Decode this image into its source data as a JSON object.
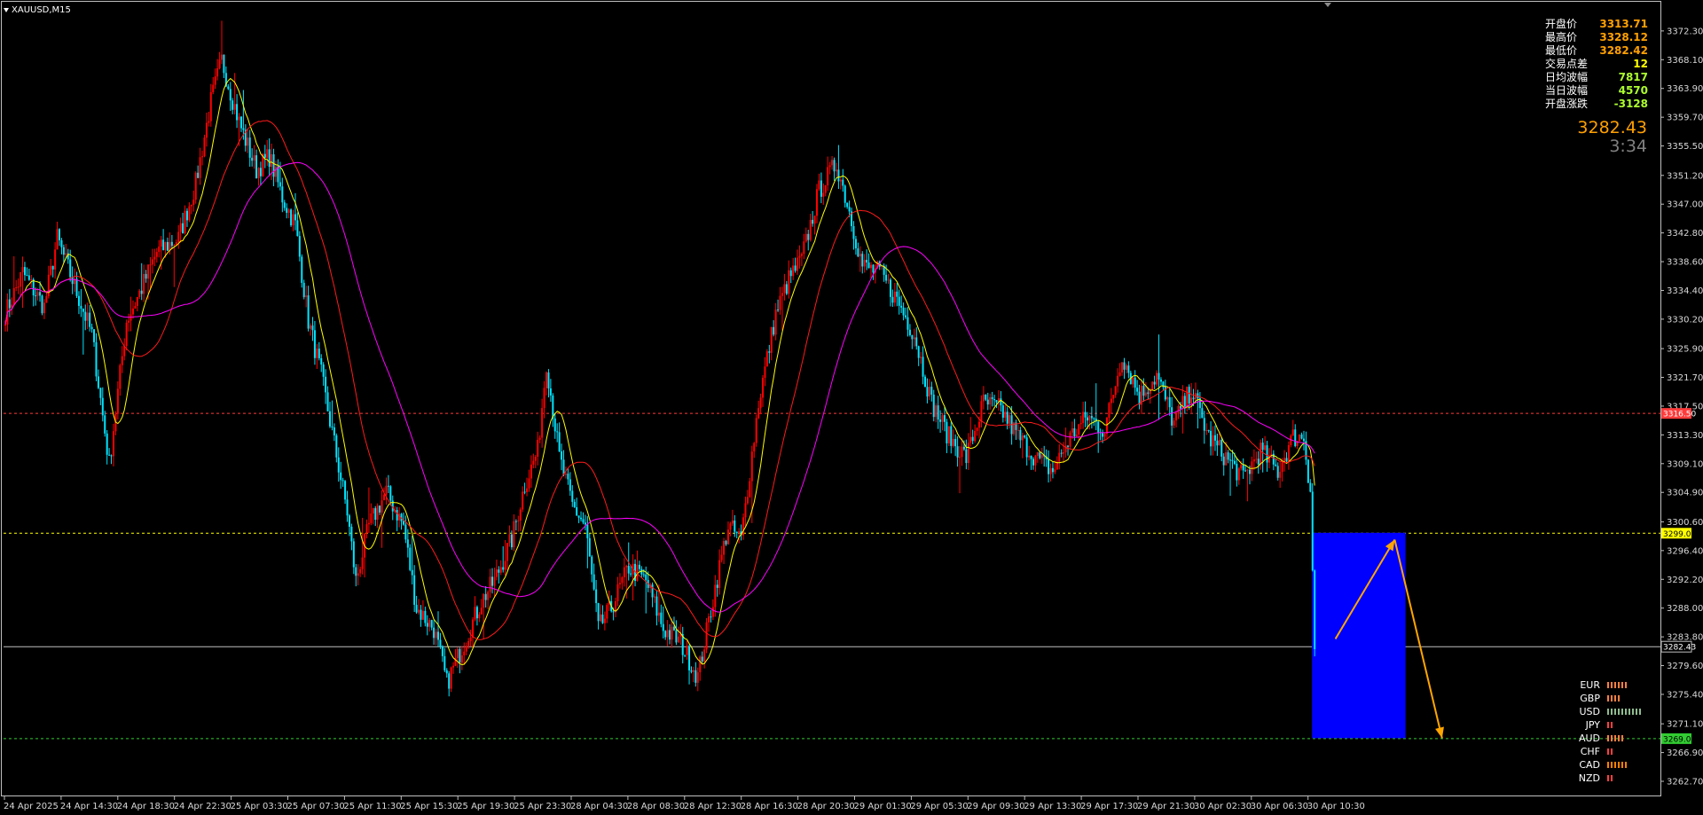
{
  "symbol": "XAUUSD,M15",
  "stats": [
    {
      "label": "开盘价",
      "value": "3313.71",
      "color": "#ffa000"
    },
    {
      "label": "最高价",
      "value": "3328.12",
      "color": "#ffa000"
    },
    {
      "label": "最低价",
      "value": "3282.42",
      "color": "#ffa000"
    },
    {
      "label": "交易点差",
      "value": "12",
      "color": "#ffff00"
    },
    {
      "label": "日均波幅",
      "value": "7817",
      "color": "#adff2f"
    },
    {
      "label": "当日波幅",
      "value": "4570",
      "color": "#adff2f"
    },
    {
      "label": "开盘涨跌",
      "value": "-3128",
      "color": "#adff2f"
    }
  ],
  "current_price": "3282.43",
  "bar_timer": "3:34",
  "colors": {
    "background": "#000000",
    "bull_candle": "#ff0000",
    "bear_candle": "#00e5ff",
    "ma_fast": "#ffff00",
    "ma_mid": "#ff1a1a",
    "ma_slow": "#ff00ff",
    "zone": "#0000ff",
    "arrow": "#ffa500"
  },
  "currency_strength": [
    {
      "currency": "EUR",
      "level": 6,
      "color": "#ff8040"
    },
    {
      "currency": "GBP",
      "level": 4,
      "color": "#ff8040"
    },
    {
      "currency": "USD",
      "level": 10,
      "color": "#8fbc8f"
    },
    {
      "currency": "JPY",
      "level": 2,
      "color": "#ff4040"
    },
    {
      "currency": "AUD",
      "level": 5,
      "color": "#ff8040"
    },
    {
      "currency": "CHF",
      "level": 2,
      "color": "#ff4040"
    },
    {
      "currency": "CAD",
      "level": 6,
      "color": "#ff8000"
    },
    {
      "currency": "NZD",
      "level": 2,
      "color": "#ff4040"
    }
  ],
  "chart_data": {
    "type": "candlestick",
    "symbol": "XAUUSD",
    "timeframe": "M15",
    "ylim": [
      3260.5,
      3376.3
    ],
    "y_ticks": [
      "3372.30",
      "3368.10",
      "3363.90",
      "3359.70",
      "3355.50",
      "3351.20",
      "3347.00",
      "3342.80",
      "3338.60",
      "3334.40",
      "3330.20",
      "3325.90",
      "3321.70",
      "3317.50",
      "3313.30",
      "3309.10",
      "3304.90",
      "3300.60",
      "3296.40",
      "3292.20",
      "3288.00",
      "3283.80",
      "3279.60",
      "3275.40",
      "3271.10",
      "3266.90",
      "3262.70"
    ],
    "x_ticks": [
      "24 Apr 2025",
      "24 Apr 14:30",
      "24 Apr 18:30",
      "24 Apr 22:30",
      "25 Apr 03:30",
      "25 Apr 07:30",
      "25 Apr 11:30",
      "25 Apr 15:30",
      "25 Apr 19:30",
      "25 Apr 23:30",
      "28 Apr 04:30",
      "28 Apr 08:30",
      "28 Apr 12:30",
      "28 Apr 16:30",
      "28 Apr 20:30",
      "29 Apr 01:30",
      "29 Apr 05:30",
      "29 Apr 09:30",
      "29 Apr 13:30",
      "29 Apr 17:30",
      "29 Apr 21:30",
      "30 Apr 02:30",
      "30 Apr 06:30",
      "30 Apr 10:30"
    ],
    "price_path": [
      [
        0,
        3331
      ],
      [
        8,
        3337
      ],
      [
        18,
        3332
      ],
      [
        24,
        3342
      ],
      [
        32,
        3335
      ],
      [
        40,
        3328
      ],
      [
        48,
        3309
      ],
      [
        56,
        3330
      ],
      [
        62,
        3334
      ],
      [
        70,
        3340
      ],
      [
        80,
        3342
      ],
      [
        88,
        3350
      ],
      [
        95,
        3362
      ],
      [
        100,
        3368
      ],
      [
        108,
        3359
      ],
      [
        116,
        3352
      ],
      [
        122,
        3354
      ],
      [
        128,
        3348
      ],
      [
        134,
        3344
      ],
      [
        140,
        3330
      ],
      [
        146,
        3322
      ],
      [
        152,
        3312
      ],
      [
        158,
        3302
      ],
      [
        162,
        3292
      ],
      [
        168,
        3300
      ],
      [
        176,
        3305
      ],
      [
        184,
        3300
      ],
      [
        190,
        3288
      ],
      [
        198,
        3285
      ],
      [
        204,
        3277
      ],
      [
        212,
        3283
      ],
      [
        220,
        3289
      ],
      [
        226,
        3292
      ],
      [
        234,
        3298
      ],
      [
        240,
        3306
      ],
      [
        246,
        3311
      ],
      [
        250,
        3324
      ],
      [
        256,
        3310
      ],
      [
        262,
        3303
      ],
      [
        268,
        3300
      ],
      [
        274,
        3285
      ],
      [
        280,
        3288
      ],
      [
        288,
        3294
      ],
      [
        296,
        3292
      ],
      [
        304,
        3285
      ],
      [
        312,
        3283
      ],
      [
        320,
        3278
      ],
      [
        328,
        3291
      ],
      [
        334,
        3300
      ],
      [
        340,
        3298
      ],
      [
        348,
        3318
      ],
      [
        356,
        3331
      ],
      [
        362,
        3336
      ],
      [
        368,
        3339
      ],
      [
        376,
        3349
      ],
      [
        384,
        3353
      ],
      [
        390,
        3346
      ],
      [
        396,
        3338
      ],
      [
        404,
        3337
      ],
      [
        412,
        3333
      ],
      [
        420,
        3328
      ],
      [
        428,
        3318
      ],
      [
        436,
        3313
      ],
      [
        444,
        3310
      ],
      [
        452,
        3318
      ],
      [
        460,
        3317
      ],
      [
        468,
        3313
      ],
      [
        476,
        3310
      ],
      [
        484,
        3308
      ],
      [
        492,
        3313
      ],
      [
        500,
        3316
      ],
      [
        508,
        3314
      ],
      [
        516,
        3325
      ],
      [
        524,
        3319
      ],
      [
        532,
        3322
      ],
      [
        540,
        3315
      ],
      [
        548,
        3320
      ],
      [
        556,
        3313
      ],
      [
        564,
        3310
      ],
      [
        572,
        3307
      ],
      [
        580,
        3311
      ],
      [
        588,
        3308
      ],
      [
        595,
        3313
      ],
      [
        600,
        3313
      ],
      [
        603,
        3305
      ],
      [
        605,
        3282
      ]
    ],
    "bar_count": 606,
    "horizontal_lines": [
      {
        "price": 3316.5,
        "label": "3316.50",
        "style": "dashed",
        "color": "#ff3b3b"
      },
      {
        "price": 3299.0,
        "label": "3299.00",
        "style": "dashed",
        "color": "#ffff00"
      },
      {
        "price": 3282.43,
        "label": "3282.43",
        "style": "solid",
        "color": "#c0c0c0"
      },
      {
        "price": 3269.0,
        "label": "3269.00",
        "style": "dashed",
        "color": "#32cd32"
      }
    ],
    "zone": {
      "from_bar": 605,
      "to_bar": 640,
      "top": 3299.0,
      "bottom": 3269.0
    },
    "projection": [
      {
        "bar": 612,
        "price": 3283.5
      },
      {
        "bar": 632,
        "price": 3298.0
      },
      {
        "bar": 648,
        "price": 3269.0
      }
    ],
    "moving_averages": [
      {
        "period": 10,
        "color": "#ffff00"
      },
      {
        "period": 30,
        "color": "#ff1a1a"
      },
      {
        "period": 60,
        "color": "#ff00ff"
      }
    ]
  }
}
